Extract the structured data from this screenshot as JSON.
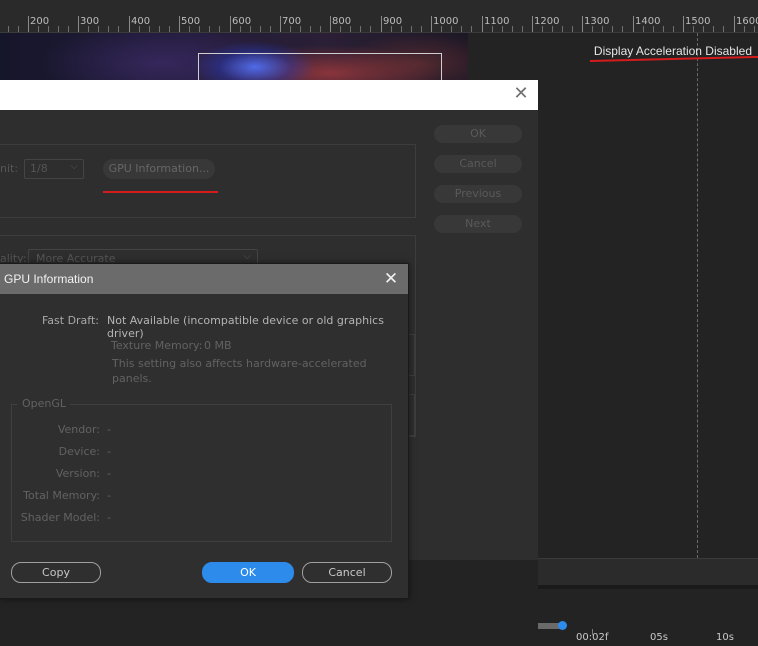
{
  "ruler": {
    "labels": [
      "200",
      "300",
      "400",
      "500",
      "600",
      "700",
      "800",
      "900",
      "1000",
      "1100",
      "1200",
      "1300",
      "1400",
      "1500",
      "1600"
    ]
  },
  "status": {
    "display_acceleration": "Display Acceleration Disabled"
  },
  "prefs_dialog": {
    "close_glyph": "✕",
    "resolution_label": "nit:",
    "resolution_value": "1/8",
    "gpu_info_button": "GPU Information...",
    "quality_label": "ality:",
    "quality_value": "More Accurate",
    "buttons": {
      "ok": "OK",
      "cancel": "Cancel",
      "previous": "Previous",
      "next": "Next"
    }
  },
  "gpu_dialog": {
    "title": "GPU Information",
    "close_glyph": "✕",
    "fast_draft_label": "Fast Draft:",
    "fast_draft_value": "Not Available (incompatible device or old graphics driver)",
    "texture_memory_label": "Texture Memory:",
    "texture_memory_value": "0 MB",
    "note_line1": "This setting also affects hardware-accelerated",
    "note_line2": "panels.",
    "opengl": {
      "legend": "OpenGL",
      "rows": [
        {
          "label": "Vendor:",
          "value": "-"
        },
        {
          "label": "Device:",
          "value": "-"
        },
        {
          "label": "Version:",
          "value": "-"
        },
        {
          "label": "Total Memory:",
          "value": "-"
        },
        {
          "label": "Shader Model:",
          "value": "-"
        }
      ]
    },
    "buttons": {
      "copy": "Copy",
      "ok": "OK",
      "cancel": "Cancel"
    }
  },
  "timeline": {
    "labels": [
      "00:02f",
      "05s",
      "10s"
    ]
  },
  "colors": {
    "accent_blue": "#2d8ceb",
    "annotation_red": "#d41c1c"
  }
}
